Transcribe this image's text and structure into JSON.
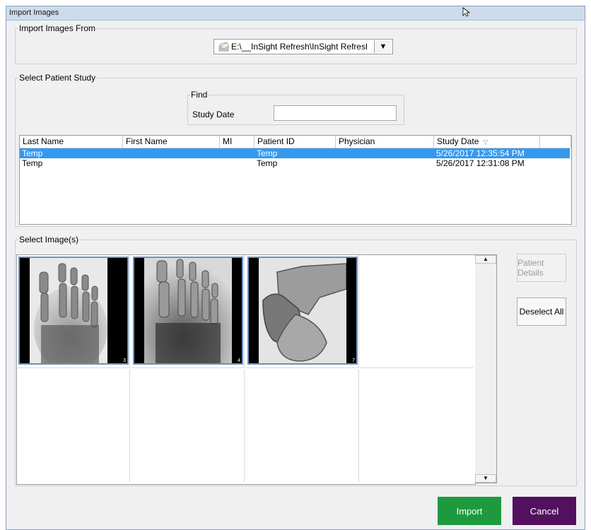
{
  "window": {
    "title": "Import Images"
  },
  "import_from": {
    "group_label": "Import Images From",
    "path_value": "E:\\__InSight Refresh\\InSight Refresl",
    "dropdown_arrow": "▼",
    "icon": "folder-document-icon"
  },
  "patient_study": {
    "group_label": "Select Patient Study",
    "find": {
      "label": "Find",
      "study_date_label": "Study Date",
      "study_date_value": ""
    },
    "columns": [
      "Last Name",
      "First Name",
      "MI",
      "Patient ID",
      "Physician",
      "Study Date"
    ],
    "sort_indicator": "▽",
    "rows": [
      {
        "last_name": "Temp",
        "first_name": "",
        "mi": "",
        "patient_id": "Temp",
        "physician": "",
        "study_date": "5/26/2017 12:35:54 PM",
        "selected": true
      },
      {
        "last_name": "Temp",
        "first_name": "",
        "mi": "",
        "patient_id": "Temp",
        "physician": "",
        "study_date": "5/26/2017 12:31:08 PM",
        "selected": false
      }
    ]
  },
  "images": {
    "group_label": "Select Image(s)",
    "thumbnails": [
      {
        "number": "3",
        "view": "foot-dorsoplantar"
      },
      {
        "number": "4",
        "view": "foot-oblique"
      },
      {
        "number": "7",
        "view": "foot-lateral"
      }
    ],
    "scroll_up": "▲",
    "scroll_down": "▼"
  },
  "buttons": {
    "patient_details": "Patient Details",
    "deselect_all": "Deselect All",
    "import": "Import",
    "cancel": "Cancel"
  },
  "colors": {
    "selection": "#3399f0",
    "import_button": "#1e9a3e",
    "cancel_button": "#52105e",
    "thumb_border": "#6d8fbf"
  }
}
